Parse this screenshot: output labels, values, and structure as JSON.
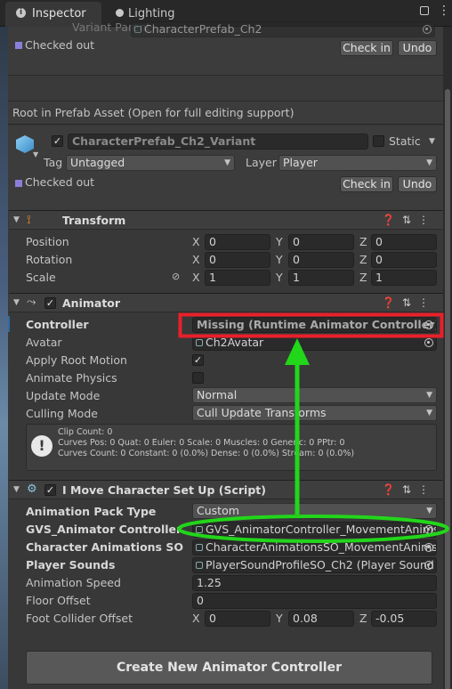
{
  "tabs": [
    {
      "label": "Inspector",
      "icon": "info-icon",
      "active": true
    },
    {
      "label": "Lighting",
      "icon": "bulb-icon",
      "active": false
    }
  ],
  "top": {
    "variant_parent_label": "Variant Parent",
    "variant_parent_value": "CharacterPrefab_Ch2",
    "checked_out": "Checked out",
    "check_in": "Check in",
    "undo": "Undo"
  },
  "root_notice": "Root in Prefab Asset (Open for full editing support)",
  "gameobject": {
    "name": "CharacterPrefab_Ch2_Variant",
    "static_label": "Static",
    "tag_label": "Tag",
    "tag_value": "Untagged",
    "layer_label": "Layer",
    "layer_value": "Player",
    "checked_out": "Checked out",
    "check_in": "Check in",
    "undo": "Undo"
  },
  "transform": {
    "title": "Transform",
    "rows": [
      {
        "label": "Position",
        "x": "0",
        "y": "0",
        "z": "0"
      },
      {
        "label": "Rotation",
        "x": "0",
        "y": "0",
        "z": "0"
      },
      {
        "label": "Scale",
        "x": "1",
        "y": "1",
        "z": "1"
      }
    ],
    "axis_x": "X",
    "axis_y": "Y",
    "axis_z": "Z"
  },
  "animator": {
    "title": "Animator",
    "controller_label": "Controller",
    "controller_value": "Missing (Runtime Animator Controller)",
    "avatar_label": "Avatar",
    "avatar_value": "Ch2Avatar",
    "apply_root_motion_label": "Apply Root Motion",
    "animate_physics_label": "Animate Physics",
    "update_mode_label": "Update Mode",
    "update_mode_value": "Normal",
    "culling_mode_label": "Culling Mode",
    "culling_mode_value": "Cull Update Transforms",
    "info_line1": "Clip Count: 0",
    "info_line2": "Curves Pos: 0 Quat: 0 Euler: 0 Scale: 0 Muscles: 0 Generic: 0 PPtr: 0",
    "info_line3": "Curves Count: 0 Constant: 0 (0.0%) Dense: 0 (0.0%) Stream: 0 (0.0%)"
  },
  "script": {
    "title": "I Move Character Set Up (Script)",
    "pack_type_label": "Animation Pack Type",
    "pack_type_value": "Custom",
    "gvs_label": "GVS_Animator Controller",
    "gvs_value": "GVS_AnimatorController_MovementAnims",
    "anim_so_label": "Character Animations SO",
    "anim_so_value": "CharacterAnimationsSO_MovementAnims",
    "sounds_label": "Player Sounds",
    "sounds_value": "PlayerSoundProfileSO_Ch2 (Player Sound",
    "speed_label": "Animation Speed",
    "speed_value": "1.25",
    "floor_label": "Floor Offset",
    "floor_value": "0",
    "foot_label": "Foot Collider Offset",
    "foot_x": "0",
    "foot_y": "0.08",
    "foot_z": "-0.05",
    "create_button": "Create New Animator Controller"
  },
  "colors": {
    "annotation_red": "#e8202a",
    "annotation_green": "#22d61a"
  }
}
